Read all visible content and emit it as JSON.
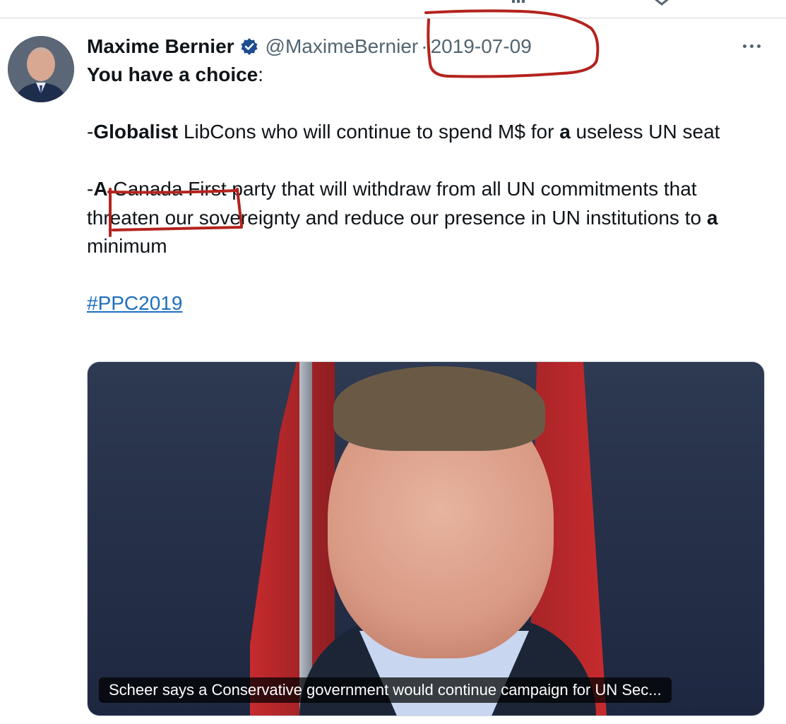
{
  "tweet": {
    "author": {
      "display_name": "Maxime Bernier",
      "handle": "@MaximeBernier",
      "verified": true
    },
    "separator": "·",
    "date": "2019-07-09",
    "more_icon": "more-horizontal-icon",
    "paragraphs": {
      "p1": {
        "bold": "You have a choice",
        "rest": ":"
      },
      "p2": {
        "dash": "-",
        "bold1": "Globalist",
        "text1": " LibCons who will continue to spend M$ for ",
        "bold2": "a",
        "text2": " useless UN seat"
      },
      "p3": {
        "dash": "-",
        "bold1": "A",
        "text1": " Canada First party that will withdraw from all UN commitments that threaten our sovereignty and reduce our presence in UN institutions to ",
        "bold2": "a",
        "text2": " minimum"
      },
      "hashtag": "#PPC2019"
    },
    "media": {
      "caption": "Scheer says a Conservative government would continue campaign for UN Sec..."
    }
  },
  "colors": {
    "text": "#0f1419",
    "secondary": "#536471",
    "link": "#1d6fbf",
    "verified_badge": "#1d4d8f",
    "annotation": "#b4231e"
  }
}
